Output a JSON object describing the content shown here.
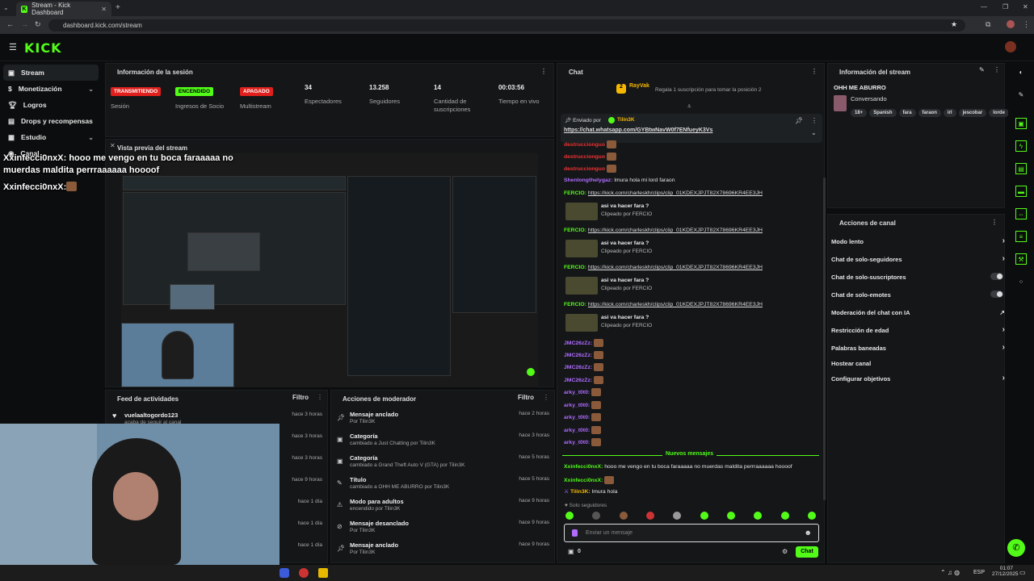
{
  "browser": {
    "tab_title": "Stream - Kick Dashboard",
    "url": "dashboard.kick.com/stream"
  },
  "app": {
    "logo": "KICK"
  },
  "sidebar": {
    "items": [
      {
        "label": "Stream",
        "icon": "broadcast-icon"
      },
      {
        "label": "Monetización",
        "icon": "money-icon"
      },
      {
        "label": "Logros",
        "icon": "trophy-icon"
      },
      {
        "label": "Drops y recompensas",
        "icon": "gift-icon"
      },
      {
        "label": "Estudio",
        "icon": "studio-icon"
      },
      {
        "label": "Canal",
        "icon": "channel-icon"
      }
    ]
  },
  "session_info": {
    "title": "Información de la sesión",
    "status": [
      {
        "badge": "TRANSMITIENDO",
        "label": "Sesión",
        "color": "#e0201d"
      },
      {
        "badge": "ENCENDIDO",
        "label": "Ingresos de Socio",
        "color": "#53fc18"
      },
      {
        "badge": "APAGADO",
        "label": "Multistream",
        "color": "#e0201d"
      }
    ],
    "stats": [
      {
        "value": "34",
        "label": "Espectadores"
      },
      {
        "value": "13.258",
        "label": "Seguidores"
      },
      {
        "value": "14",
        "label": "Cantidad de suscripciones"
      },
      {
        "value": "00:03:56",
        "label": "Tiempo en vivo"
      }
    ]
  },
  "preview": {
    "title": "Vista previa del stream"
  },
  "overlay": {
    "line1": "Xxinfecci0nxX: hooo me vengo en tu boca faraaaaa no",
    "line2": "muerdas maldita perrraaaaaa hoooof",
    "line3": "Xxinfecci0nxX:"
  },
  "activity_feed": {
    "title": "Feed de actividades",
    "filter": "Filtro",
    "rows": [
      {
        "user": "vuelaaltogordo123",
        "sub": "acaba de seguir al canal",
        "time": "hace 3 horas"
      },
      {
        "user": "",
        "sub": "",
        "time": "hace 3 horas"
      },
      {
        "user": "",
        "sub": "",
        "time": "hace 3 horas"
      },
      {
        "user": "",
        "sub": "",
        "time": "hace 9 horas"
      },
      {
        "user": "",
        "sub": "",
        "time": "hace 1 día"
      },
      {
        "user": "",
        "sub": "",
        "time": "hace 1 día"
      },
      {
        "user": "",
        "sub": "",
        "time": "hace 1 día"
      }
    ]
  },
  "mod_actions": {
    "title": "Acciones de moderador",
    "filter": "Filtro",
    "rows": [
      {
        "icon": "pin-icon",
        "title": "Mensaje anclado",
        "sub": "Por Tilin3K",
        "time": "hace 2 horas"
      },
      {
        "icon": "category-icon",
        "title": "Categoría",
        "sub": "cambiado a Just Chatting por Tilin3K",
        "time": "hace 3 horas"
      },
      {
        "icon": "category-icon",
        "title": "Categoría",
        "sub": "cambiado a Grand Theft Auto V (GTA) por Tilin3K",
        "time": "hace 5 horas"
      },
      {
        "icon": "title-icon",
        "title": "Título",
        "sub": "cambiado a OHH ME ABURRO por Tilin3K",
        "time": "hace 5 horas"
      },
      {
        "icon": "adult-icon",
        "title": "Modo para adultos",
        "sub": "encendido por Tilin3K",
        "time": "hace 9 horas"
      },
      {
        "icon": "unpin-icon",
        "title": "Mensaje desanclado",
        "sub": "Por Tilin3K",
        "time": "hace 9 horas"
      },
      {
        "icon": "pin-icon",
        "title": "Mensaje anclado",
        "sub": "Por Tilin3K",
        "time": "hace 9 horas"
      }
    ]
  },
  "chat": {
    "title": "Chat",
    "top_user": "RayVak",
    "top_rank": "2",
    "gift_msg": "Regala 1 suscripción para tomar la posición 2",
    "pinned_by_label": "Enviado por",
    "pinned_by_user": "Tilin3K",
    "pinned_link": "https://chat.whatsapp.com/GYBtwNavW0f7ENfueyK3Vs",
    "red_user_1": "destruccionguo",
    "red_user_2": "destruccionguo",
    "red_user_3": "destruccionguo",
    "shen_user": "Shenlongthelygaz:",
    "shen_msg": "lmura hola mi lord faraon",
    "clip_user": "FERCIO:",
    "clip_link": "https://kick.com/charleskh/clips/clip_01KDEXJPJT82X78696KR4EE3JH",
    "clip_title": "asi va hacer fara ?",
    "clip_by": "Clipeado por FERCIO",
    "jmc_user": "JMC26zZz:",
    "arky_user": "arky_t0t0:",
    "new_msgs": "Nuevos mensajes",
    "msg1_user": "Xxinfecci0nxX:",
    "msg1_text": "hooo me vengo en tu boca faraaaaa no muerdas maldita perrraaaaaa hoooof",
    "msg2_user": "Xxinfecci0nxX:",
    "msg3_user": "Tilin3K:",
    "msg3_text": "lmura hola",
    "followers_only": "Solo seguidores",
    "input_placeholder": "Enviar un mensaje",
    "count": "0",
    "send_label": "Chat"
  },
  "stream_info": {
    "title": "Información del stream",
    "stream_title": "OHH ME ABURRO",
    "category": "Conversando",
    "tags": [
      "18+",
      "Spanish",
      "fara",
      "faraon",
      "irl",
      "jescobar",
      "lorde"
    ]
  },
  "channel_actions": {
    "title": "Acciones de canal",
    "items": [
      {
        "label": "Modo lento",
        "control": "arrow"
      },
      {
        "label": "Chat de solo-seguidores",
        "control": "arrow"
      },
      {
        "label": "Chat de solo-suscriptores",
        "control": "toggle"
      },
      {
        "label": "Chat de solo-emotes",
        "control": "toggle"
      },
      {
        "label": "Moderación del chat con IA",
        "control": "external"
      },
      {
        "label": "Restricción de edad",
        "control": "arrow"
      },
      {
        "label": "Palabras baneadas",
        "control": "arrow"
      },
      {
        "label": "Hostear canal",
        "control": "none"
      },
      {
        "label": "Configurar objetivos",
        "control": "arrow"
      }
    ]
  },
  "taskbar": {
    "lang": "ESP",
    "time": "01:07",
    "date": "27/12/2025"
  },
  "colors": {
    "accent": "#53fc18",
    "danger": "#e0201d",
    "purple": "#b06cff"
  }
}
